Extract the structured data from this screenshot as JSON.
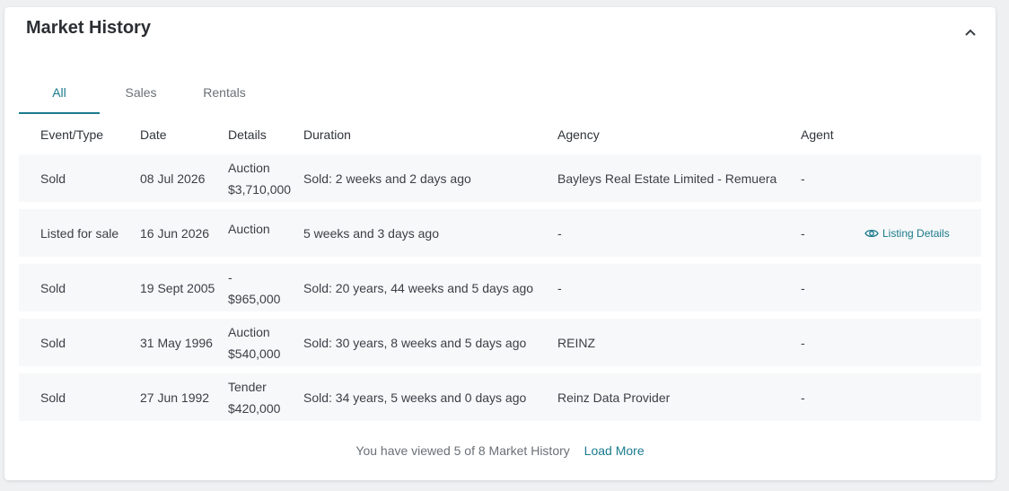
{
  "section": {
    "title": "Market History"
  },
  "tabs": [
    {
      "label": "All",
      "active": true
    },
    {
      "label": "Sales",
      "active": false
    },
    {
      "label": "Rentals",
      "active": false
    }
  ],
  "table": {
    "columns": [
      "Event/Type",
      "Date",
      "Details",
      "Duration",
      "Agency",
      "Agent"
    ],
    "rows": [
      {
        "event": "Sold",
        "date": "08 Jul 2026",
        "details_line1": "Auction",
        "details_line2": "$3,710,000",
        "duration": "Sold: 2 weeks and 2 days ago",
        "agency": "Bayleys Real Estate Limited - Remuera",
        "agent": "-",
        "action": ""
      },
      {
        "event": "Listed for sale",
        "date": "16 Jun 2026",
        "details_line1": "Auction",
        "details_line2": "",
        "duration": "5 weeks and 3 days ago",
        "agency": "-",
        "agent": "-",
        "action": "Listing Details"
      },
      {
        "event": "Sold",
        "date": "19 Sept 2005",
        "details_line1": "-",
        "details_line2": "$965,000",
        "duration": "Sold: 20 years, 44 weeks and 5 days ago",
        "agency": "-",
        "agent": "-",
        "action": ""
      },
      {
        "event": "Sold",
        "date": "31 May 1996",
        "details_line1": "Auction",
        "details_line2": "$540,000",
        "duration": "Sold: 30 years, 8 weeks and 5 days ago",
        "agency": "REINZ",
        "agent": "-",
        "action": ""
      },
      {
        "event": "Sold",
        "date": "27 Jun 1992",
        "details_line1": "Tender",
        "details_line2": "$420,000",
        "duration": "Sold: 34 years, 5 weeks and 0 days ago",
        "agency": "Reinz Data Provider",
        "agent": "-",
        "action": ""
      }
    ]
  },
  "footer": {
    "summary": "You have viewed 5 of 8 Market History",
    "load_more": "Load More"
  },
  "icons": {
    "collapse": "chevron-up-icon",
    "listing": "eye-icon"
  },
  "colors": {
    "accent": "#1a7a8c",
    "row_bg": "#f7f8f9"
  }
}
